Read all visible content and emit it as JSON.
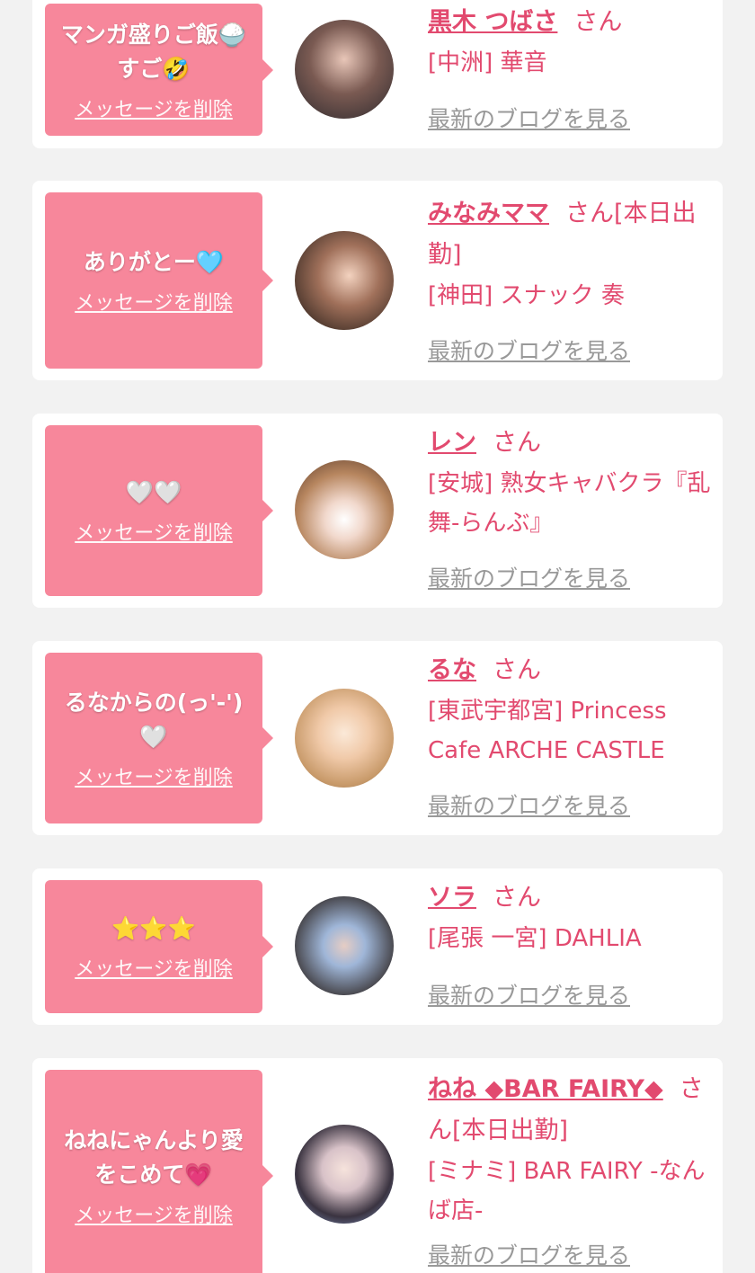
{
  "cards": [
    {
      "message": "マンガ盛りご飯🍚\nすご🤣",
      "delete_label": "メッセージを削除",
      "name": "黒木 つばさ",
      "honorific": "さん",
      "status": "",
      "shop": "[中洲] 華音",
      "blog_label": "最新のブログを見る"
    },
    {
      "message": "ありがとー🩵",
      "delete_label": "メッセージを削除",
      "name": "みなみママ",
      "honorific": "さん",
      "status": "[本日出勤]",
      "shop": "[神田] スナック 奏",
      "blog_label": "最新のブログを見る"
    },
    {
      "message": "🤍🤍",
      "delete_label": "メッセージを削除",
      "name": "レン",
      "honorific": "さん",
      "status": "",
      "shop": "[安城] 熟女キャバクラ『乱舞-らんぶ』",
      "blog_label": "最新のブログを見る"
    },
    {
      "message": "るなからの(っ'-')\n🤍",
      "delete_label": "メッセージを削除",
      "name": "るな",
      "honorific": "さん",
      "status": "",
      "shop": "[東武宇都宮] Princess Cafe ARCHE CASTLE",
      "blog_label": "最新のブログを見る"
    },
    {
      "message": "⭐⭐⭐",
      "delete_label": "メッセージを削除",
      "name": "ソラ",
      "honorific": "さん",
      "status": "",
      "shop": "[尾張 一宮] DAHLIA",
      "blog_label": "最新のブログを見る"
    },
    {
      "message": "ねねにゃんより愛\nをこめて💗",
      "delete_label": "メッセージを削除",
      "name": "ねね ◆BAR FAIRY◆",
      "honorific": "さん",
      "status": "[本日出勤]",
      "shop": "[ミナミ] BAR FAIRY -なんば店-",
      "blog_label": "最新のブログを見る"
    }
  ],
  "colors": {
    "accent": "#e24a6f",
    "bubble": "#f7879b",
    "link_gray": "#999999",
    "background": "#f2f2f2"
  }
}
